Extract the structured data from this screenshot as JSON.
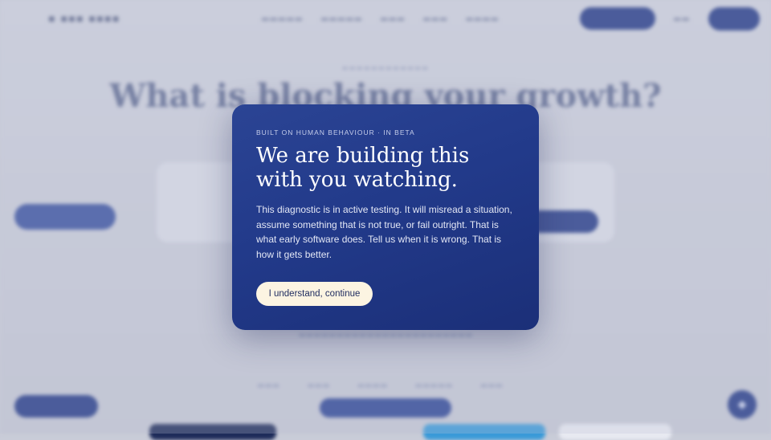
{
  "modal": {
    "eyebrow": "BUILT ON HUMAN BEHAVIOUR · IN BETA",
    "title": "We are building this with you watching.",
    "body": "This diagnostic is in active testing. It will misread a situation, assume something that is not true, or fail outright. That is what early software does. Tell us when it is wrong. That is how it gets better.",
    "button_label": "I understand, continue"
  },
  "background": {
    "hero_title": "What is blocking your growth?"
  },
  "colors": {
    "modal_bg": "#223a8a",
    "button_bg": "#fcf4e2",
    "brand_navy": "#243a87"
  }
}
